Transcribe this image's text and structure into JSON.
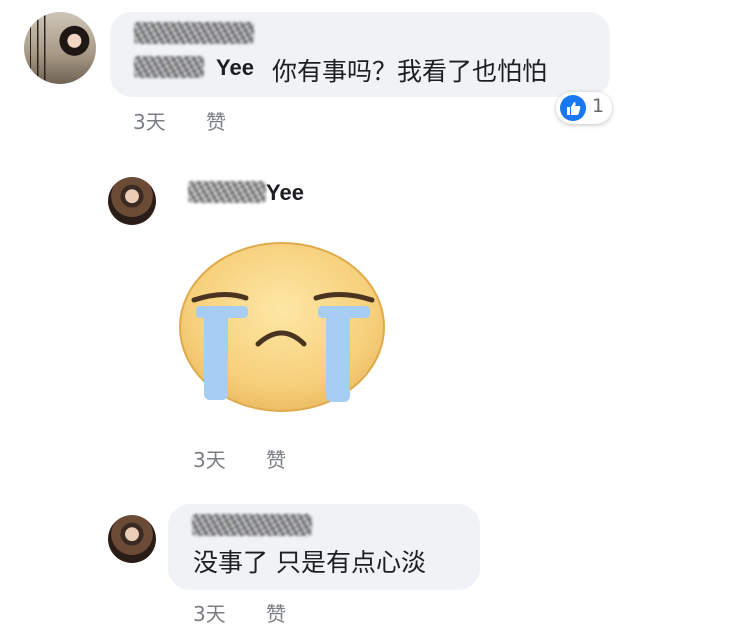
{
  "comments": [
    {
      "author_visible": "Yee",
      "text": "你有事吗？我看了也怕怕",
      "time": "3天",
      "like_label": "赞",
      "reaction_count": "1"
    },
    {
      "author_visible": "Yee",
      "sticker": "crying-face-sticker",
      "time": "3天",
      "like_label": "赞"
    },
    {
      "text": "没事了 只是有点心淡",
      "time": "3天",
      "like_label": "赞"
    }
  ],
  "colors": {
    "bubble": "#f0f2f5",
    "like_blue": "#1877f2",
    "meta_gray": "#7a7d82"
  }
}
